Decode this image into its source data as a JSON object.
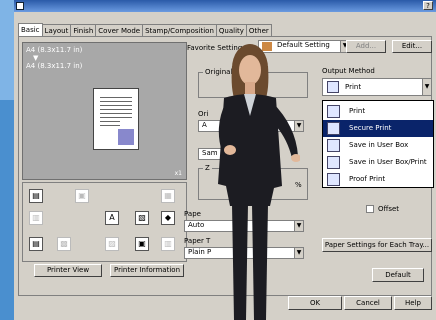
{
  "window": {
    "help_glyph": "?"
  },
  "tabs": [
    {
      "label": "Basic",
      "active": true
    },
    {
      "label": "Layout"
    },
    {
      "label": "Finish"
    },
    {
      "label": "Cover Mode"
    },
    {
      "label": "Stamp/Composition"
    },
    {
      "label": "Quality"
    },
    {
      "label": "Other"
    }
  ],
  "preview": {
    "paper_size_1": "A4 (8.3x11.7 in)",
    "arrow": "▼",
    "paper_size_2": "A4 (8.3x11.7 in)",
    "copies": "x1"
  },
  "left_buttons": {
    "printer_view": "Printer View",
    "printer_information": "Printer Information"
  },
  "favorite": {
    "label": "Favorite Setting",
    "value": "Default Setting",
    "add": "Add...",
    "edit": "Edit..."
  },
  "fields": {
    "original_orientation": "Original Or",
    "orig": "Ori",
    "orig_value": "A",
    "sam": "Sam",
    "zoom_label": "Z",
    "zoom_unit": "%",
    "paper_tray_label": "Pape",
    "paper_tray_value": "Auto",
    "paper_type_label": "Paper T",
    "paper_type_value": "Plain P"
  },
  "output_method": {
    "label": "Output Method",
    "current": "Print",
    "options": [
      {
        "label": "Print",
        "selected": false
      },
      {
        "label": "Secure Print",
        "selected": true
      },
      {
        "label": "Save in User Box",
        "selected": false
      },
      {
        "label": "Save in User Box/Print",
        "selected": false
      },
      {
        "label": "Proof Print",
        "selected": false
      }
    ],
    "offset": "Offset"
  },
  "right_buttons": {
    "paper_settings": "Paper Settings for Each Tray...",
    "default": "Default"
  },
  "footer": {
    "ok": "OK",
    "cancel": "Cancel",
    "help": "Help"
  }
}
